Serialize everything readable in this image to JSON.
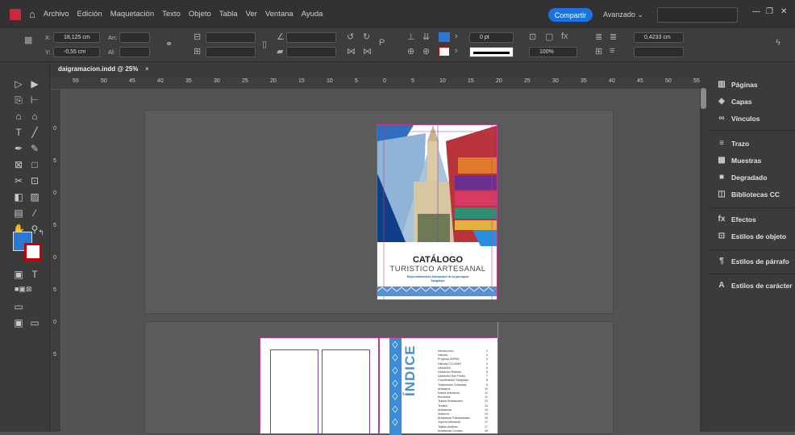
{
  "menubar": {
    "items": [
      "Archivo",
      "Edición",
      "Maquetación",
      "Texto",
      "Objeto",
      "Tabla",
      "Ver",
      "Ventana",
      "Ayuda"
    ],
    "share": "Compartir",
    "workspace": "Avanzado ⌄"
  },
  "control": {
    "x_label": "X:",
    "x_value": "18,125 cm",
    "y_label": "Y:",
    "y_value": "-0,55 cm",
    "w_label": "An:",
    "h_label": "Al:",
    "stroke_weight": "0 pt",
    "zoom": "100%",
    "gutter": "0,4233 cm"
  },
  "document": {
    "tab_title": "daigramacion.indd @ 25%",
    "tab_close": "×"
  },
  "ruler": {
    "top": [
      "55",
      "50",
      "45",
      "40",
      "35",
      "30",
      "25",
      "20",
      "15",
      "10",
      "5",
      "0",
      "5",
      "10",
      "15",
      "20",
      "25",
      "30",
      "35",
      "40",
      "45",
      "50",
      "55"
    ],
    "left": [
      "0",
      "5",
      "0",
      "5",
      "0",
      "5",
      "0",
      "5"
    ]
  },
  "cover": {
    "title": "CATÁLOGO",
    "subtitle": "TURISTICO ARTESANAL",
    "tagline": "Emprendimientos Artesanales de la parroquia Sangolquí"
  },
  "index": {
    "heading": "ÍNDICE",
    "entries": [
      {
        "label": "Introducción",
        "page": "2"
      },
      {
        "label": "Historia",
        "page": "3"
      },
      {
        "label": "Proyecto ARPAC",
        "page": "4"
      },
      {
        "label": "Historia CCUSMO",
        "page": "4"
      },
      {
        "label": "Ubicación",
        "page": "5"
      },
      {
        "label": "Ubicación Palmas",
        "page": "6"
      },
      {
        "label": "Ubicación San Pedro",
        "page": "7"
      },
      {
        "label": "Coordinación Sangolquí",
        "page": "8"
      },
      {
        "label": "Tradiciones Culinarias",
        "page": "9"
      },
      {
        "label": "Artesanía",
        "page": "10"
      },
      {
        "label": "Nueva Artesanía",
        "page": "11"
      },
      {
        "label": "Bordados",
        "page": "12"
      },
      {
        "label": "Tejidos Artesanales",
        "page": "12"
      },
      {
        "label": "Textiles",
        "page": "13"
      },
      {
        "label": "Artesanías",
        "page": "14"
      },
      {
        "label": "Alfarería",
        "page": "15"
      },
      {
        "label": "Artesanías Patrimoniales",
        "page": "16"
      },
      {
        "label": "Joyería Artesanal",
        "page": "17"
      },
      {
        "label": "Tejidos Andinos",
        "page": "17"
      },
      {
        "label": "Artesanías Locales",
        "page": "18"
      }
    ]
  },
  "panels": [
    {
      "icon": "pages-icon",
      "glyph": "▥",
      "label": "Páginas"
    },
    {
      "icon": "layers-icon",
      "glyph": "◈",
      "label": "Capas"
    },
    {
      "icon": "links-icon",
      "glyph": "∞",
      "label": "Vínculos"
    },
    {
      "icon": "stroke-icon",
      "glyph": "≡",
      "label": "Trazo"
    },
    {
      "icon": "swatches-icon",
      "glyph": "▦",
      "label": "Muestras"
    },
    {
      "icon": "gradient-icon",
      "glyph": "■",
      "label": "Degradado"
    },
    {
      "icon": "cc-libraries-icon",
      "glyph": "◫",
      "label": "Bibliotecas CC"
    },
    {
      "icon": "effects-icon",
      "glyph": "fx",
      "label": "Efectos"
    },
    {
      "icon": "object-styles-icon",
      "glyph": "⊡",
      "label": "Estilos de objeto"
    },
    {
      "icon": "paragraph-styles-icon",
      "glyph": "¶",
      "label": "Estilos de párrafo"
    },
    {
      "icon": "character-styles-icon",
      "glyph": "A",
      "label": "Estilos de carácter"
    }
  ],
  "colors": {
    "accent": "#1b72e0",
    "fill": "#2a78d4",
    "cover_blue": "#2b8fe0",
    "guide": "#c03b8a",
    "index_blue": "#3a8dd6"
  }
}
